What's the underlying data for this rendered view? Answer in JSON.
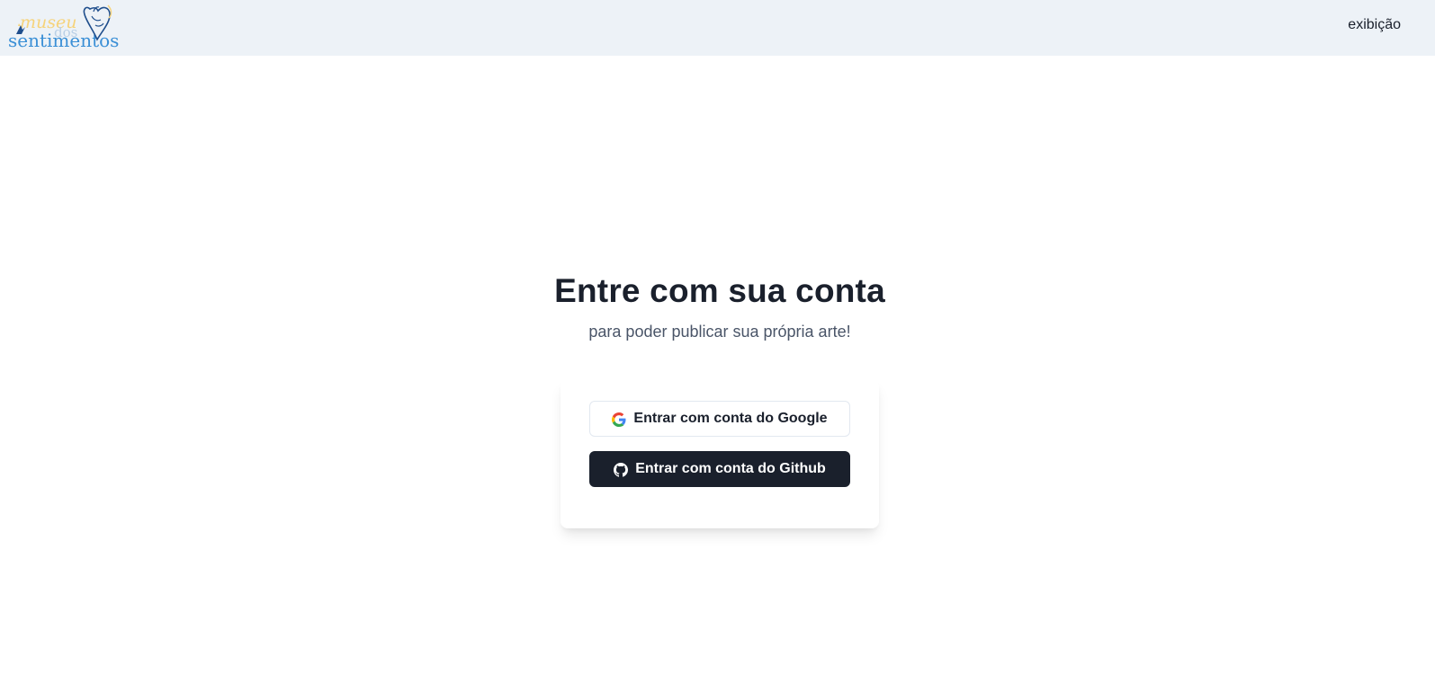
{
  "header": {
    "logo": {
      "line1": "museu",
      "line_mid": "dos",
      "line2": "sentimentos",
      "colors": {
        "yellow": "#f6d37a",
        "blue": "#3a8fd6",
        "light_blue": "#b9cfe6",
        "navy": "#1f4e8c"
      }
    },
    "nav": {
      "exhibition_label": "exibição"
    }
  },
  "login": {
    "title": "Entre com sua conta",
    "subtitle": "para poder publicar sua própria arte!",
    "google_button": {
      "label": "Entrar com conta do Google",
      "icon": "google-icon"
    },
    "github_button": {
      "label": "Entrar com conta do Github",
      "icon": "github-icon"
    }
  },
  "colors": {
    "navbar_bg": "#edf2f7",
    "text_dark": "#1a202c",
    "text_muted": "#4a5568",
    "github_bg": "#1a202c",
    "border": "#e2e8f0"
  }
}
